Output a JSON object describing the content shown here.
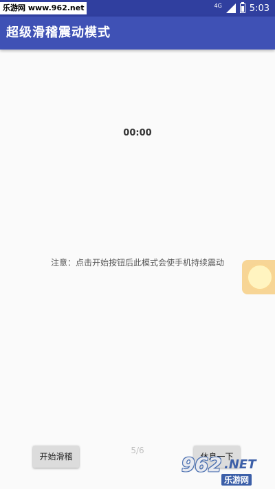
{
  "status_bar": {
    "watermark": "乐游网 www.962.net",
    "network": "4G",
    "time": "5:03"
  },
  "app_bar": {
    "title": "超级滑稽震动模式"
  },
  "main": {
    "timer": "00:00",
    "notice": "注意：点击开始按钮后此模式会使手机持续震动"
  },
  "bottom": {
    "start_label": "开始滑稽",
    "page_indicator": "5/6",
    "rest_label": "休息一下"
  },
  "watermark_logo": {
    "number": "962",
    "suffix": ".NET",
    "cn": "乐游网"
  },
  "colors": {
    "status_bar": "#303f9f",
    "app_bar": "#3f51b5",
    "background": "#fafafa",
    "button": "#dcdcdc"
  }
}
